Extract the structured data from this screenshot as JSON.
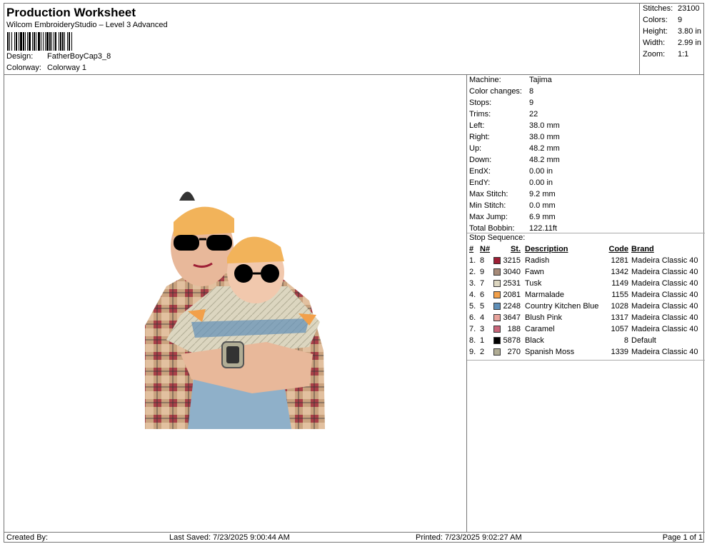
{
  "header": {
    "title": "Production Worksheet",
    "subtitle": "Wilcom EmbroideryStudio – Level 3 Advanced",
    "design_label": "Design:",
    "design_value": "FatherBoyCap3_8",
    "colorway_label": "Colorway:",
    "colorway_value": "Colorway 1"
  },
  "stats": [
    {
      "label": "Stitches:",
      "value": "23100"
    },
    {
      "label": "Colors:",
      "value": "9"
    },
    {
      "label": "Height:",
      "value": "3.80 in"
    },
    {
      "label": "Width:",
      "value": "2.99 in"
    },
    {
      "label": "Zoom:",
      "value": "1:1"
    }
  ],
  "properties": [
    {
      "label": "Machine:",
      "value": "Tajima"
    },
    {
      "label": "Color changes:",
      "value": "8"
    },
    {
      "label": "Stops:",
      "value": "9"
    },
    {
      "label": "Trims:",
      "value": "22"
    },
    {
      "label": "Left:",
      "value": "38.0 mm"
    },
    {
      "label": "Right:",
      "value": "38.0 mm"
    },
    {
      "label": "Up:",
      "value": "48.2 mm"
    },
    {
      "label": "Down:",
      "value": "48.2 mm"
    },
    {
      "label": "EndX:",
      "value": "0.00 in"
    },
    {
      "label": "EndY:",
      "value": "0.00 in"
    },
    {
      "label": "Max Stitch:",
      "value": "9.2 mm"
    },
    {
      "label": "Min Stitch:",
      "value": "0.0 mm"
    },
    {
      "label": "Max Jump:",
      "value": "6.9 mm"
    },
    {
      "label": "Total Bobbin:",
      "value": "122.11ft"
    }
  ],
  "sequence": {
    "title": "Stop Sequence:",
    "headers": {
      "idx": "#",
      "num": "N#",
      "st": "St.",
      "desc": "Description",
      "code": "Code",
      "brand": "Brand"
    },
    "rows": [
      {
        "idx": "1.",
        "num": "8",
        "color": "#9e1f35",
        "st": "3215",
        "desc": "Radish",
        "code": "1281",
        "brand": "Madeira Classic 40"
      },
      {
        "idx": "2.",
        "num": "9",
        "color": "#a68a78",
        "st": "3040",
        "desc": "Fawn",
        "code": "1342",
        "brand": "Madeira Classic 40"
      },
      {
        "idx": "3.",
        "num": "7",
        "color": "#dcd6c0",
        "st": "2531",
        "desc": "Tusk",
        "code": "1149",
        "brand": "Madeira Classic 40"
      },
      {
        "idx": "4.",
        "num": "6",
        "color": "#f2a04a",
        "st": "2081",
        "desc": "Marmalade",
        "code": "1155",
        "brand": "Madeira Classic 40"
      },
      {
        "idx": "5.",
        "num": "5",
        "color": "#5f8fb8",
        "st": "2248",
        "desc": "Country Kitchen Blue",
        "code": "1028",
        "brand": "Madeira Classic 40"
      },
      {
        "idx": "6.",
        "num": "4",
        "color": "#e8a39c",
        "st": "3647",
        "desc": "Blush Pink",
        "code": "1317",
        "brand": "Madeira Classic 40"
      },
      {
        "idx": "7.",
        "num": "3",
        "color": "#c9667a",
        "st": "188",
        "desc": "Caramel",
        "code": "1057",
        "brand": "Madeira Classic 40"
      },
      {
        "idx": "8.",
        "num": "1",
        "color": "#000000",
        "st": "5878",
        "desc": "Black",
        "code": "8",
        "brand": "Default"
      },
      {
        "idx": "9.",
        "num": "2",
        "color": "#b1ad95",
        "st": "270",
        "desc": "Spanish Moss",
        "code": "1339",
        "brand": "Madeira Classic 40"
      }
    ]
  },
  "footer": {
    "created_by": "Created By:",
    "last_saved": "Last Saved: 7/23/2025 9:00:44 AM",
    "printed": "Printed: 7/23/2025 9:02:27 AM",
    "page": "Page 1 of 1"
  }
}
